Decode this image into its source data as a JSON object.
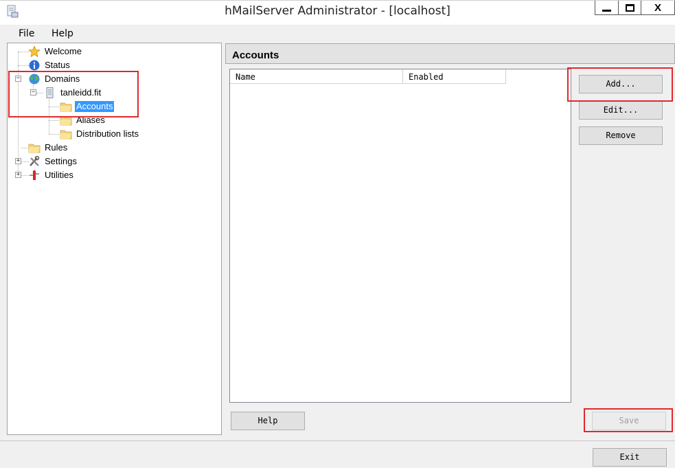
{
  "window": {
    "title": "hMailServer Administrator - [localhost]",
    "close_glyph": "X"
  },
  "menu": {
    "file": "File",
    "help": "Help"
  },
  "tree": {
    "welcome": "Welcome",
    "status": "Status",
    "domains": "Domains",
    "domain_name": "tanleidd.fit",
    "accounts": "Accounts",
    "aliases": "Aliases",
    "distribution_lists": "Distribution lists",
    "rules": "Rules",
    "settings": "Settings",
    "utilities": "Utilities"
  },
  "main": {
    "title": "Accounts",
    "columns": [
      "Name",
      "Enabled"
    ]
  },
  "buttons": {
    "add": "Add...",
    "edit": "Edit...",
    "remove": "Remove",
    "help": "Help",
    "save": "Save",
    "exit": "Exit"
  },
  "colors": {
    "highlight_box": "#e0282e",
    "selection": "#3399ff"
  }
}
